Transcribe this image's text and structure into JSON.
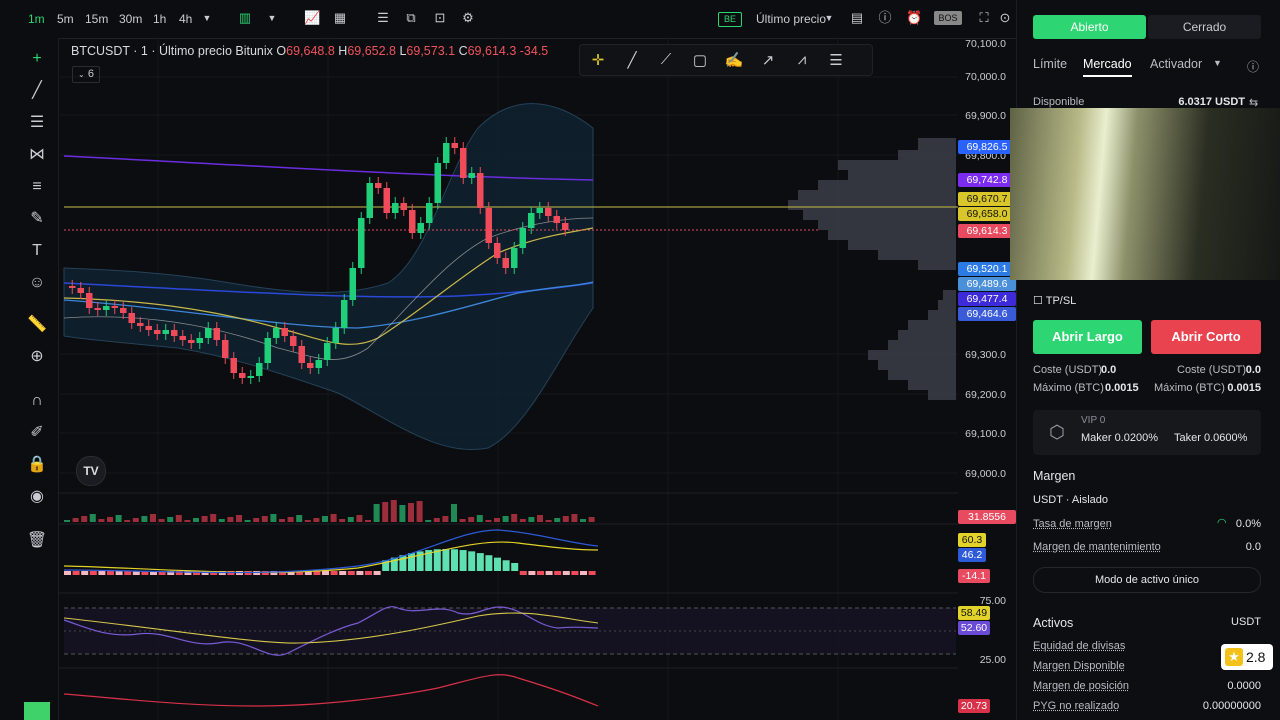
{
  "toolbar": {
    "timeframes": [
      "1m",
      "5m",
      "15m",
      "30m",
      "1h",
      "4h"
    ],
    "active_timeframe": "1m",
    "price_source": "Último precio",
    "badge": "BE"
  },
  "legend": {
    "symbol": "BTCUSDT · 1 · Último precio Bitunix",
    "o_label": "O",
    "o": "69,648.8",
    "h_label": "H",
    "h": "69,652.8",
    "l_label": "L",
    "l": "69,573.1",
    "c_label": "C",
    "c": "69,614.3",
    "change": "-34.5",
    "indicators_count": "6"
  },
  "price_axis": [
    "70,000.0",
    "69,900.0",
    "69,800.0",
    "69,300.0",
    "69,200.0",
    "69,100.0",
    "69,000.0"
  ],
  "price_labels": [
    {
      "text": "69,826.5",
      "color": "#2962ff"
    },
    {
      "text": "69,742.8",
      "color": "#7b2cf0"
    },
    {
      "text": "69,670.7",
      "color": "#d8c62a"
    },
    {
      "text": "69,658.0",
      "color": "#d8c62a"
    },
    {
      "text": "69,614.3",
      "color": "#e84a5f"
    },
    {
      "text": "69,520.1",
      "color": "#2c7be5"
    },
    {
      "text": "69,489.6",
      "color": "#4a90d9"
    },
    {
      "text": "69,477.4",
      "color": "#3d2ad8"
    },
    {
      "text": "69,464.6",
      "color": "#3a5bd8"
    }
  ],
  "volume_label": "31.8556",
  "macd_labels": [
    {
      "text": "60.3",
      "color": "#e2d32a"
    },
    {
      "text": "46.2",
      "color": "#2c5ad8"
    },
    {
      "text": "-14.1",
      "color": "#e84a5f"
    }
  ],
  "rsi": {
    "top": "75.00",
    "bottom": "25.00",
    "v1": "58.49",
    "v2": "52.60"
  },
  "bottom_indicator": "20.73",
  "panel": {
    "tabs": [
      "Abierto",
      "Cerrado"
    ],
    "order_types": [
      "Límite",
      "Mercado",
      "Activador"
    ],
    "disponible_label": "Disponible",
    "disponible_value": "6.0317 USDT",
    "tpsl": "TP/SL",
    "abrir_largo": "Abrir Largo",
    "abrir_corto": "Abrir Corto",
    "coste_label": "Coste (USDT)",
    "coste_left": "0.0",
    "coste_right": "0.0",
    "max_label": "Máximo (BTC)",
    "max_left": "0.0015",
    "max_right": "0.0015",
    "vip": "VIP 0",
    "maker": "Maker 0.0200%",
    "taker": "Taker 0.0600%",
    "margen_title": "Margen",
    "margin_mode": "USDT · Aislado",
    "tasa_label": "Tasa de margen",
    "tasa_value": "0.0%",
    "mant_label": "Margen de mantenimiento",
    "mant_value": "0.0",
    "single_asset": "Modo de activo único",
    "activos": "Activos",
    "activos_currency": "USDT",
    "equidad": "Equidad de divisas",
    "disp": "Margen Disponible",
    "posicion": "Margen de posición",
    "posicion_value": "0.0000",
    "pyg": "PYG no realizado",
    "pyg_value": "0.00000000",
    "rating": "2.8"
  }
}
